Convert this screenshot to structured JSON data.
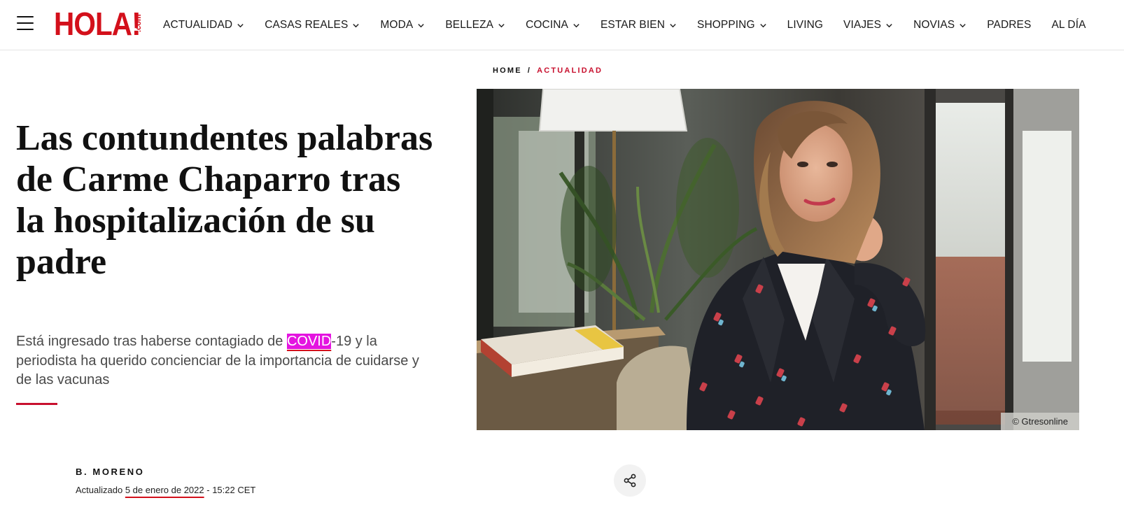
{
  "header": {
    "logo": "HOLA!",
    "logo_suffix": ".com",
    "nav": [
      {
        "label": "ACTUALIDAD",
        "dropdown": true
      },
      {
        "label": "CASAS REALES",
        "dropdown": true
      },
      {
        "label": "MODA",
        "dropdown": true
      },
      {
        "label": "BELLEZA",
        "dropdown": true
      },
      {
        "label": "COCINA",
        "dropdown": true
      },
      {
        "label": "ESTAR BIEN",
        "dropdown": true
      },
      {
        "label": "SHOPPING",
        "dropdown": true
      },
      {
        "label": "LIVING",
        "dropdown": false
      },
      {
        "label": "VIAJES",
        "dropdown": true
      },
      {
        "label": "NOVIAS",
        "dropdown": true
      },
      {
        "label": "PADRES",
        "dropdown": false
      },
      {
        "label": "AL DÍA",
        "dropdown": false
      }
    ]
  },
  "breadcrumb": {
    "home": "HOME",
    "separator": "/",
    "current": "ACTUALIDAD"
  },
  "article": {
    "title": "Las contundentes palabras de Carme Chaparro tras la hospitalización de su padre",
    "subtitle_before": "Está ingresado tras haberse contagiado de ",
    "subtitle_highlight": "COVID",
    "subtitle_after": "-19 y la periodista ha querido concienciar de la importancia de cuidarse y de las vacunas",
    "image_credit": "© Gtresonline",
    "author": "B. MORENO",
    "updated_label": "Actualizado",
    "updated_date": "5 de enero de 2022",
    "updated_time": "- 15:22 CET"
  },
  "colors": {
    "brand_red": "#d3101b",
    "breadcrumb_red": "#c8102e",
    "search_highlight": "#e414e0"
  },
  "icons": {
    "menu": "hamburger-menu-icon",
    "dropdown": "chevron-down-icon",
    "share": "share-icon"
  }
}
